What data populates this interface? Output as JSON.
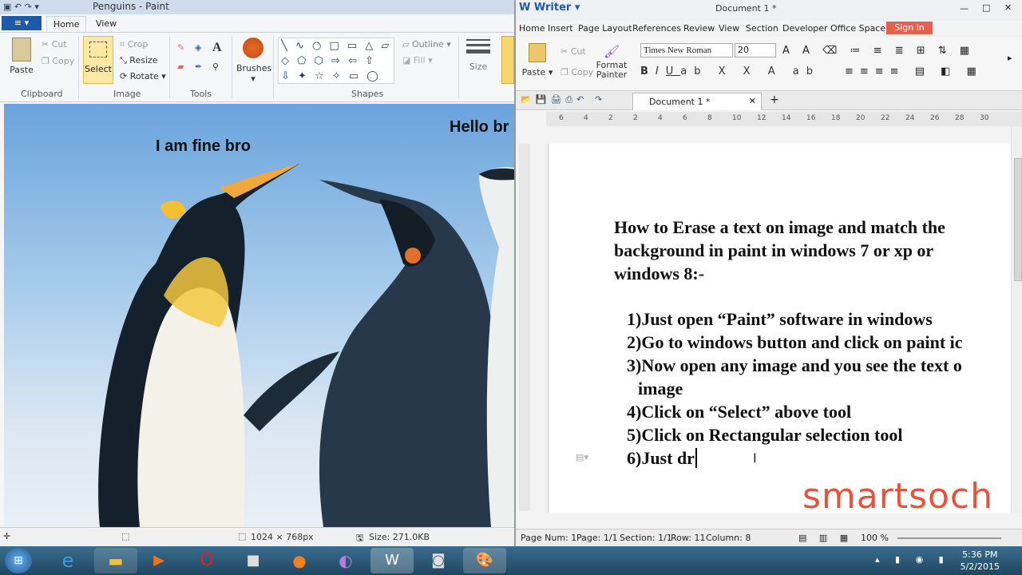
{
  "paint": {
    "title": "Penguins - Paint",
    "file_button": "",
    "tabs": [
      "Home",
      "View"
    ],
    "clipboard": {
      "paste": "Paste",
      "cut": "Cut",
      "copy": "Copy",
      "group": "Clipboard"
    },
    "image": {
      "select": "Select",
      "crop": "Crop",
      "resize": "Resize",
      "rotate": "Rotate",
      "group": "Image"
    },
    "tools": {
      "group": "Tools"
    },
    "brushes": "Brushes",
    "shapes": {
      "group": "Shapes",
      "outline": "Outline",
      "fill": "Fill"
    },
    "size": "Size",
    "canvas_text_1": "I am fine bro",
    "canvas_text_2": "Hello br",
    "status": {
      "dimensions": "1024 × 768px",
      "size": "Size: 271.0KB"
    }
  },
  "writer": {
    "app_name": "Writer",
    "doc_title": "Document 1 *",
    "menu": [
      "Home",
      "Insert",
      "Page Layout",
      "References",
      "Review",
      "View",
      "Section",
      "Developer",
      "Office Space"
    ],
    "sign_in": "Sign in",
    "toolbar": {
      "paste": "Paste",
      "cut": "Cut",
      "copy": "Copy",
      "format_painter_1": "Format",
      "format_painter_2": "Painter",
      "font": "Times New Roman",
      "size": "20"
    },
    "doc_tab": "Document 1 *",
    "ruler_ticks": [
      "6",
      "4",
      "2",
      "2",
      "4",
      "6",
      "8",
      "10",
      "12",
      "14",
      "16",
      "18",
      "20",
      "22",
      "24",
      "26",
      "28",
      "30"
    ],
    "heading": [
      "How to Erase a text on image and match the",
      "background in paint in windows 7 or xp or",
      "windows 8:-"
    ],
    "steps": [
      "1)Just open “Paint” software in windows",
      "2)Go to windows button and click on paint ic",
      "3)Now open any image and you see the text o",
      "image",
      "4)Click on “Select” above tool",
      "5)Click on Rectangular selection tool",
      "6)Just dr"
    ],
    "status": {
      "page_num": "Page Num: 1",
      "page": "Page: 1/1",
      "section": "Section: 1/1",
      "row": "Row: 11",
      "column": "Column: 8",
      "zoom": "100 %"
    }
  },
  "watermark": "smartsoch",
  "taskbar": {
    "time": "5:36 PM",
    "date": "5/2/2015"
  }
}
